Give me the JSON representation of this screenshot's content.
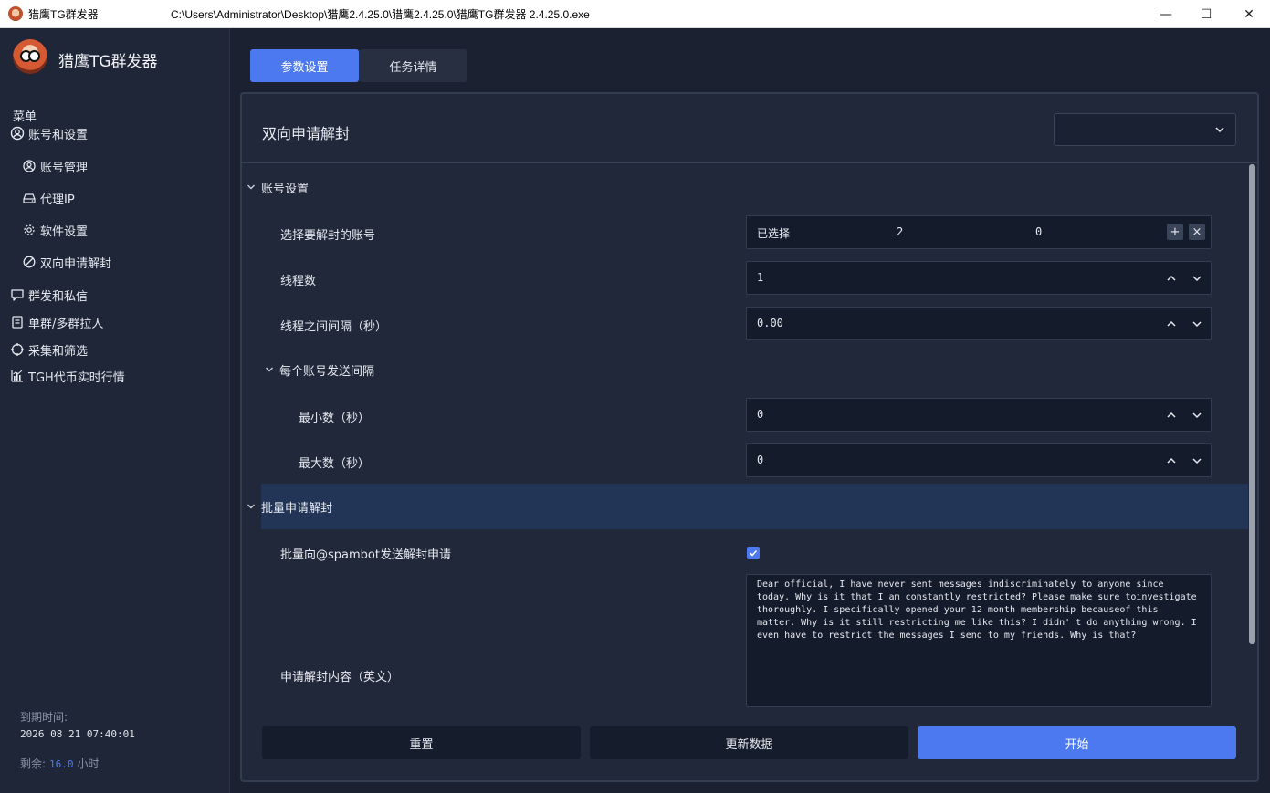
{
  "window": {
    "app_name": "猎鹰TG群发器",
    "path": "C:\\Users\\Administrator\\Desktop\\猎鹰2.4.25.0\\猎鹰2.4.25.0\\猎鹰TG群发器 2.4.25.0.exe",
    "controls": {
      "minimize": "—",
      "maximize": "☐",
      "close": "✕"
    }
  },
  "sidebar": {
    "brand": "猎鹰TG群发器",
    "menu_title": "菜单",
    "items": [
      {
        "label": "账号和设置",
        "icon": "user-circle-icon"
      },
      {
        "label": "账号管理",
        "icon": "user-circle-icon"
      },
      {
        "label": "代理IP",
        "icon": "server-icon"
      },
      {
        "label": "软件设置",
        "icon": "gear-icon"
      },
      {
        "label": "双向申请解封",
        "icon": "ban-icon"
      },
      {
        "label": "群发和私信",
        "icon": "chat-bubble-icon"
      },
      {
        "label": "单群/多群拉人",
        "icon": "document-icon"
      },
      {
        "label": "采集和筛选",
        "icon": "crosshair-icon"
      },
      {
        "label": "TGH代币实时行情",
        "icon": "bar-chart-icon"
      }
    ],
    "expire_label": "到期时间:",
    "expire_value": "2026 08 21 07:40:01",
    "remain_label": "剩余:",
    "remain_value": "16.0",
    "remain_unit": "小时"
  },
  "tabs": [
    {
      "label": "参数设置",
      "active": true
    },
    {
      "label": "任务详情",
      "active": false
    }
  ],
  "panel": {
    "title": "双向申请解封",
    "select_value": ""
  },
  "sections": {
    "account": {
      "title": "账号设置",
      "select_accounts": {
        "label": "选择要解封的账号",
        "prefix": "已选择",
        "count_a": "2",
        "count_b": "0",
        "add": "+",
        "remove": "×"
      },
      "threads": {
        "label": "线程数",
        "value": "1"
      },
      "thread_interval": {
        "label": "线程之间间隔（秒）",
        "value": "0.00"
      },
      "per_account_interval": {
        "title": "每个账号发送间隔",
        "min": {
          "label": "最小数（秒）",
          "value": "0"
        },
        "max": {
          "label": "最大数（秒）",
          "value": "0"
        }
      }
    },
    "batch": {
      "title": "批量申请解封",
      "spambot": {
        "label": "批量向@spambot发送解封申请",
        "checked": true
      },
      "content": {
        "label": "申请解封内容（英文）",
        "value": "Dear official, I have never sent messages indiscriminately to anyone since today. Why is it that I am constantly restricted? Please make sure toinvestigate thoroughly. I specifically opened your 12 month membership becauseof this matter. Why is it still restricting me like this? I didn' t do anything wrong. I even have to restrict the messages I send to my friends. Why is that?"
      }
    }
  },
  "actions": {
    "reset": "重置",
    "refresh": "更新数据",
    "start": "开始"
  },
  "colors": {
    "accent": "#4c78f0",
    "sidebar_bg": "#1e2637",
    "panel_bg": "#20283a",
    "input_bg": "#141b2b"
  }
}
